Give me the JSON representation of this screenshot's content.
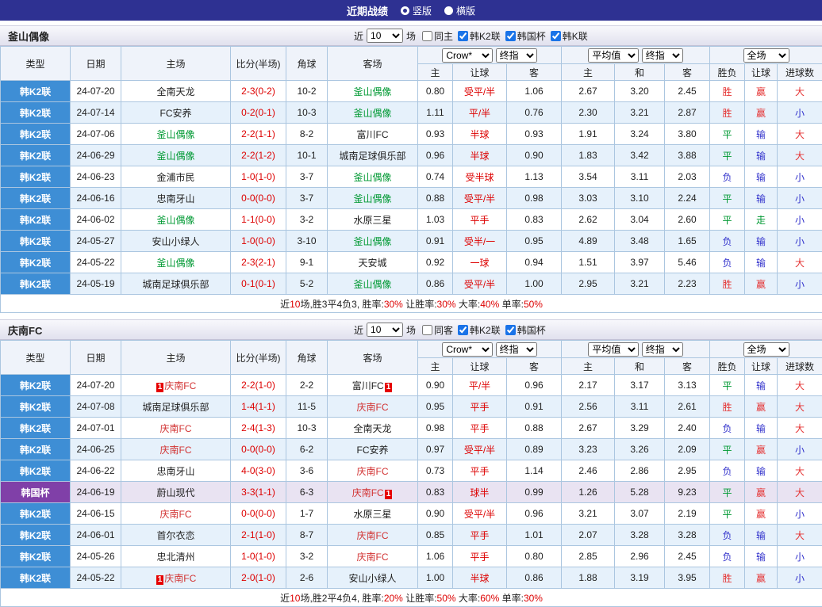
{
  "top_bar": {
    "title": "近期战绩",
    "options": [
      {
        "label": "竖版",
        "selected": true
      },
      {
        "label": "横版",
        "selected": false
      }
    ]
  },
  "table_header": {
    "type": "类型",
    "date": "日期",
    "home": "主场",
    "score": "比分(半场)",
    "corner": "角球",
    "away": "客场",
    "odds_selects": [
      "Crow*",
      "终指"
    ],
    "avg_selects": [
      "平均值",
      "终指"
    ],
    "scope_select": "全场",
    "odds_cols": [
      "主",
      "让球",
      "客"
    ],
    "avg_cols": [
      "主",
      "和",
      "客"
    ],
    "result_cols": [
      "胜负",
      "让球",
      "进球数"
    ]
  },
  "colors": {
    "topbar_bg": "#2e3192",
    "row_stripe": "#e6f1fb",
    "cup_row_stripe": "#e9e3f2",
    "grid_border": "#abc6e0",
    "score_red": "#dd0000",
    "red_card": "#e60000"
  },
  "league_colors": {
    "韩K2联": "#3e8ed5",
    "韩国杯": "#8040a8"
  },
  "result_colors": {
    "胜": "#e53333",
    "平": "#009933",
    "负": "#3333cc",
    "赢": "#e53333",
    "输": "#3333cc",
    "走": "#009933",
    "大": "#e53333",
    "小": "#3333cc"
  },
  "sections": [
    {
      "team": "釜山偶像",
      "team_color": "#009933",
      "controls": {
        "near": "近",
        "count": "10",
        "games": "场",
        "checkboxes": [
          {
            "label": "同主",
            "checked": false
          },
          {
            "label": "韩K2联",
            "checked": true
          },
          {
            "label": "韩国杯",
            "checked": true
          },
          {
            "label": "韩K联",
            "checked": true
          }
        ]
      },
      "rows": [
        {
          "league": "韩K2联",
          "date": "24-07-20",
          "home": "全南天龙",
          "home_self": false,
          "home_rc": false,
          "score": "2-3(0-2)",
          "corner": "10-2",
          "away": "釜山偶像",
          "away_self": true,
          "away_rc": false,
          "odds": [
            "0.80",
            "受平/半",
            "1.06"
          ],
          "avg": [
            "2.67",
            "3.20",
            "2.45"
          ],
          "results": [
            "胜",
            "赢",
            "大"
          ]
        },
        {
          "league": "韩K2联",
          "date": "24-07-14",
          "home": "FC安养",
          "home_self": false,
          "home_rc": false,
          "score": "0-2(0-1)",
          "corner": "10-3",
          "away": "釜山偶像",
          "away_self": true,
          "away_rc": false,
          "odds": [
            "1.11",
            "平/半",
            "0.76"
          ],
          "avg": [
            "2.30",
            "3.21",
            "2.87"
          ],
          "results": [
            "胜",
            "赢",
            "小"
          ]
        },
        {
          "league": "韩K2联",
          "date": "24-07-06",
          "home": "釜山偶像",
          "home_self": true,
          "home_rc": false,
          "score": "2-2(1-1)",
          "corner": "8-2",
          "away": "富川FC",
          "away_self": false,
          "away_rc": false,
          "odds": [
            "0.93",
            "半球",
            "0.93"
          ],
          "avg": [
            "1.91",
            "3.24",
            "3.80"
          ],
          "results": [
            "平",
            "输",
            "大"
          ]
        },
        {
          "league": "韩K2联",
          "date": "24-06-29",
          "home": "釜山偶像",
          "home_self": true,
          "home_rc": false,
          "score": "2-2(1-2)",
          "corner": "10-1",
          "away": "城南足球俱乐部",
          "away_self": false,
          "away_rc": false,
          "odds": [
            "0.96",
            "半球",
            "0.90"
          ],
          "avg": [
            "1.83",
            "3.42",
            "3.88"
          ],
          "results": [
            "平",
            "输",
            "大"
          ]
        },
        {
          "league": "韩K2联",
          "date": "24-06-23",
          "home": "金浦市民",
          "home_self": false,
          "home_rc": false,
          "score": "1-0(1-0)",
          "corner": "3-7",
          "away": "釜山偶像",
          "away_self": true,
          "away_rc": false,
          "odds": [
            "0.74",
            "受半球",
            "1.13"
          ],
          "avg": [
            "3.54",
            "3.11",
            "2.03"
          ],
          "results": [
            "负",
            "输",
            "小"
          ]
        },
        {
          "league": "韩K2联",
          "date": "24-06-16",
          "home": "忠南牙山",
          "home_self": false,
          "home_rc": false,
          "score": "0-0(0-0)",
          "corner": "3-7",
          "away": "釜山偶像",
          "away_self": true,
          "away_rc": false,
          "odds": [
            "0.88",
            "受平/半",
            "0.98"
          ],
          "avg": [
            "3.03",
            "3.10",
            "2.24"
          ],
          "results": [
            "平",
            "输",
            "小"
          ]
        },
        {
          "league": "韩K2联",
          "date": "24-06-02",
          "home": "釜山偶像",
          "home_self": true,
          "home_rc": false,
          "score": "1-1(0-0)",
          "corner": "3-2",
          "away": "水原三星",
          "away_self": false,
          "away_rc": false,
          "odds": [
            "1.03",
            "平手",
            "0.83"
          ],
          "avg": [
            "2.62",
            "3.04",
            "2.60"
          ],
          "results": [
            "平",
            "走",
            "小"
          ]
        },
        {
          "league": "韩K2联",
          "date": "24-05-27",
          "home": "安山小绿人",
          "home_self": false,
          "home_rc": false,
          "score": "1-0(0-0)",
          "corner": "3-10",
          "away": "釜山偶像",
          "away_self": true,
          "away_rc": false,
          "odds": [
            "0.91",
            "受半/一",
            "0.95"
          ],
          "avg": [
            "4.89",
            "3.48",
            "1.65"
          ],
          "results": [
            "负",
            "输",
            "小"
          ]
        },
        {
          "league": "韩K2联",
          "date": "24-05-22",
          "home": "釜山偶像",
          "home_self": true,
          "home_rc": false,
          "score": "2-3(2-1)",
          "corner": "9-1",
          "away": "天安城",
          "away_self": false,
          "away_rc": false,
          "odds": [
            "0.92",
            "一球",
            "0.94"
          ],
          "avg": [
            "1.51",
            "3.97",
            "5.46"
          ],
          "results": [
            "负",
            "输",
            "大"
          ]
        },
        {
          "league": "韩K2联",
          "date": "24-05-19",
          "home": "城南足球俱乐部",
          "home_self": false,
          "home_rc": false,
          "score": "0-1(0-1)",
          "corner": "5-2",
          "away": "釜山偶像",
          "away_self": true,
          "away_rc": false,
          "odds": [
            "0.86",
            "受平/半",
            "1.00"
          ],
          "avg": [
            "2.95",
            "3.21",
            "2.23"
          ],
          "results": [
            "胜",
            "赢",
            "小"
          ]
        }
      ],
      "footer": [
        {
          "text": "近",
          "red": false
        },
        {
          "text": "10",
          "red": true
        },
        {
          "text": "场,胜3平4负3, 胜率:",
          "red": false
        },
        {
          "text": "30%",
          "red": true
        },
        {
          "text": " 让胜率:",
          "red": false
        },
        {
          "text": "30%",
          "red": true
        },
        {
          "text": " 大率:",
          "red": false
        },
        {
          "text": "40%",
          "red": true
        },
        {
          "text": " 单率:",
          "red": false
        },
        {
          "text": "50%",
          "red": true
        }
      ]
    },
    {
      "team": "庆南FC",
      "team_color": "#d23333",
      "controls": {
        "near": "近",
        "count": "10",
        "games": "场",
        "checkboxes": [
          {
            "label": "同客",
            "checked": false
          },
          {
            "label": "韩K2联",
            "checked": true
          },
          {
            "label": "韩国杯",
            "checked": true
          }
        ]
      },
      "rows": [
        {
          "league": "韩K2联",
          "date": "24-07-20",
          "home": "庆南FC",
          "home_self": true,
          "home_rc": true,
          "score": "2-2(1-0)",
          "corner": "2-2",
          "away": "富川FC",
          "away_self": false,
          "away_rc": true,
          "odds": [
            "0.90",
            "平/半",
            "0.96"
          ],
          "avg": [
            "2.17",
            "3.17",
            "3.13"
          ],
          "results": [
            "平",
            "输",
            "大"
          ]
        },
        {
          "league": "韩K2联",
          "date": "24-07-08",
          "home": "城南足球俱乐部",
          "home_self": false,
          "home_rc": false,
          "score": "1-4(1-1)",
          "corner": "11-5",
          "away": "庆南FC",
          "away_self": true,
          "away_rc": false,
          "odds": [
            "0.95",
            "平手",
            "0.91"
          ],
          "avg": [
            "2.56",
            "3.11",
            "2.61"
          ],
          "results": [
            "胜",
            "赢",
            "大"
          ]
        },
        {
          "league": "韩K2联",
          "date": "24-07-01",
          "home": "庆南FC",
          "home_self": true,
          "home_rc": false,
          "score": "2-4(1-3)",
          "corner": "10-3",
          "away": "全南天龙",
          "away_self": false,
          "away_rc": false,
          "odds": [
            "0.98",
            "平手",
            "0.88"
          ],
          "avg": [
            "2.67",
            "3.29",
            "2.40"
          ],
          "results": [
            "负",
            "输",
            "大"
          ]
        },
        {
          "league": "韩K2联",
          "date": "24-06-25",
          "home": "庆南FC",
          "home_self": true,
          "home_rc": false,
          "score": "0-0(0-0)",
          "corner": "6-2",
          "away": "FC安养",
          "away_self": false,
          "away_rc": false,
          "odds": [
            "0.97",
            "受平/半",
            "0.89"
          ],
          "avg": [
            "3.23",
            "3.26",
            "2.09"
          ],
          "results": [
            "平",
            "赢",
            "小"
          ]
        },
        {
          "league": "韩K2联",
          "date": "24-06-22",
          "home": "忠南牙山",
          "home_self": false,
          "home_rc": false,
          "score": "4-0(3-0)",
          "corner": "3-6",
          "away": "庆南FC",
          "away_self": true,
          "away_rc": false,
          "odds": [
            "0.73",
            "平手",
            "1.14"
          ],
          "avg": [
            "2.46",
            "2.86",
            "2.95"
          ],
          "results": [
            "负",
            "输",
            "大"
          ]
        },
        {
          "league": "韩国杯",
          "date": "24-06-19",
          "home": "蔚山现代",
          "home_self": false,
          "home_rc": false,
          "score": "3-3(1-1)",
          "corner": "6-3",
          "away": "庆南FC",
          "away_self": true,
          "away_rc": true,
          "odds": [
            "0.83",
            "球半",
            "0.99"
          ],
          "avg": [
            "1.26",
            "5.28",
            "9.23"
          ],
          "results": [
            "平",
            "赢",
            "大"
          ]
        },
        {
          "league": "韩K2联",
          "date": "24-06-15",
          "home": "庆南FC",
          "home_self": true,
          "home_rc": false,
          "score": "0-0(0-0)",
          "corner": "1-7",
          "away": "水原三星",
          "away_self": false,
          "away_rc": false,
          "odds": [
            "0.90",
            "受平/半",
            "0.96"
          ],
          "avg": [
            "3.21",
            "3.07",
            "2.19"
          ],
          "results": [
            "平",
            "赢",
            "小"
          ]
        },
        {
          "league": "韩K2联",
          "date": "24-06-01",
          "home": "首尔衣恋",
          "home_self": false,
          "home_rc": false,
          "score": "2-1(1-0)",
          "corner": "8-7",
          "away": "庆南FC",
          "away_self": true,
          "away_rc": false,
          "odds": [
            "0.85",
            "平手",
            "1.01"
          ],
          "avg": [
            "2.07",
            "3.28",
            "3.28"
          ],
          "results": [
            "负",
            "输",
            "大"
          ]
        },
        {
          "league": "韩K2联",
          "date": "24-05-26",
          "home": "忠北清州",
          "home_self": false,
          "home_rc": false,
          "score": "1-0(1-0)",
          "corner": "3-2",
          "away": "庆南FC",
          "away_self": true,
          "away_rc": false,
          "odds": [
            "1.06",
            "平手",
            "0.80"
          ],
          "avg": [
            "2.85",
            "2.96",
            "2.45"
          ],
          "results": [
            "负",
            "输",
            "小"
          ]
        },
        {
          "league": "韩K2联",
          "date": "24-05-22",
          "home": "庆南FC",
          "home_self": true,
          "home_rc": true,
          "score": "2-0(1-0)",
          "corner": "2-6",
          "away": "安山小绿人",
          "away_self": false,
          "away_rc": false,
          "odds": [
            "1.00",
            "半球",
            "0.86"
          ],
          "avg": [
            "1.88",
            "3.19",
            "3.95"
          ],
          "results": [
            "胜",
            "赢",
            "小"
          ]
        }
      ],
      "footer": [
        {
          "text": "近",
          "red": false
        },
        {
          "text": "10",
          "red": true
        },
        {
          "text": "场,胜2平4负4, 胜率:",
          "red": false
        },
        {
          "text": "20%",
          "red": true
        },
        {
          "text": " 让胜率:",
          "red": false
        },
        {
          "text": "50%",
          "red": true
        },
        {
          "text": " 大率:",
          "red": false
        },
        {
          "text": "60%",
          "red": true
        },
        {
          "text": " 单率:",
          "red": false
        },
        {
          "text": "30%",
          "red": true
        }
      ]
    }
  ]
}
